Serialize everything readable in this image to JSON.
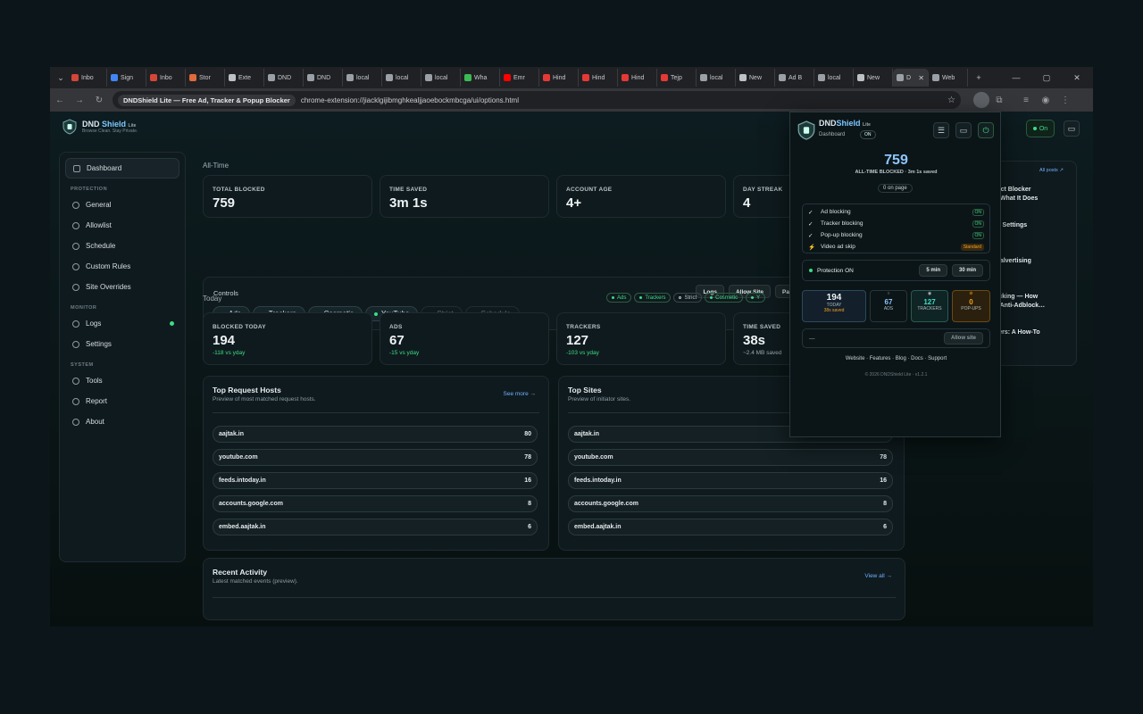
{
  "browser": {
    "tabs": [
      "Inbo",
      "Sign",
      "Inbo",
      "Stor",
      "Exte",
      "DND",
      "DND",
      "local",
      "local",
      "local",
      "Wha",
      "Emr",
      "Hind",
      "Hind",
      "Hind",
      "Tejp",
      "local",
      "New",
      "Ad B",
      "local",
      "New",
      "D",
      "Web"
    ],
    "tab_colors": [
      "#d44638",
      "#4285f4",
      "#d44638",
      "#e06a3a",
      "#bdc1c6",
      "#9aa0a6",
      "#9aa0a6",
      "#9aa0a6",
      "#9aa0a6",
      "#9aa0a6",
      "#3cba54",
      "#ff0000",
      "#e53935",
      "#e53935",
      "#e53935",
      "#e53935",
      "#9aa0a6",
      "#bdc1c6",
      "#9aa0a6",
      "#9aa0a6",
      "#bdc1c6",
      "#9aa0a6",
      "#9aa0a6"
    ],
    "chip_label": "DNDShield Lite — Free Ad, Tracker & Popup Blocker",
    "url": "chrome-extension://jiacklgijibmghkealjjaoebockmbcga/ui/options.html",
    "new_tab": "+",
    "window_controls": [
      "—",
      "▢",
      "✕"
    ]
  },
  "brand": {
    "name_a": "DND ",
    "name_b": "Shield",
    "lite": "Lite",
    "tagline": "Browse Clean. Stay Private."
  },
  "sidebar": {
    "dashboard": "Dashboard",
    "protection_head": "PROTECTION",
    "protection": [
      "General",
      "Allowlist",
      "Schedule",
      "Custom Rules",
      "Site Overrides"
    ],
    "monitor_head": "MONITOR",
    "monitor": [
      "Logs",
      "Settings"
    ],
    "system_head": "SYSTEM",
    "system": [
      "Tools",
      "Report",
      "About"
    ]
  },
  "alltime": {
    "label": "All-Time",
    "stats": [
      {
        "label": "TOTAL BLOCKED",
        "value": "759"
      },
      {
        "label": "TIME SAVED",
        "value": "3m 1s"
      },
      {
        "label": "ACCOUNT AGE",
        "value": "4+"
      },
      {
        "label": "DAY STREAK",
        "value": "4"
      }
    ]
  },
  "controls": {
    "title": "Controls",
    "buttons": [
      "Logs",
      "Allow Site",
      "Pause 10m"
    ],
    "toggles": [
      {
        "label": "Ads",
        "on": true
      },
      {
        "label": "Trackers",
        "on": true
      },
      {
        "label": "Cosmetic",
        "on": true
      },
      {
        "label": "YouTube",
        "on": true
      },
      {
        "label": "Strict",
        "on": false
      },
      {
        "label": "Schedule",
        "on": false
      }
    ]
  },
  "today": {
    "label": "Today",
    "mode_pills": [
      "Ads",
      "Trackers",
      "Strict",
      "Cosmetic",
      "Y"
    ],
    "stats": [
      {
        "label": "BLOCKED TODAY",
        "value": "194",
        "sub": "-118 vs yday"
      },
      {
        "label": "ADS",
        "value": "67",
        "sub": "-15 vs yday"
      },
      {
        "label": "TRACKERS",
        "value": "127",
        "sub": "-103 vs yday"
      },
      {
        "label": "TIME SAVED",
        "value": "38s",
        "sub": "~2.4 MB saved"
      }
    ]
  },
  "top_hosts": {
    "title": "Top Request Hosts",
    "subtitle": "Preview of most matched request hosts.",
    "see_more": "See more →",
    "rows": [
      {
        "host": "aajtak.in",
        "count": "80"
      },
      {
        "host": "youtube.com",
        "count": "78"
      },
      {
        "host": "feeds.intoday.in",
        "count": "16"
      },
      {
        "host": "accounts.google.com",
        "count": "8"
      },
      {
        "host": "embed.aajtak.in",
        "count": "6"
      }
    ]
  },
  "top_sites": {
    "title": "Top Sites",
    "subtitle": "Preview of initiator sites.",
    "rows": [
      {
        "host": "aajtak.in",
        "count": "80"
      },
      {
        "host": "youtube.com",
        "count": "78"
      },
      {
        "host": "feeds.intoday.in",
        "count": "16"
      },
      {
        "host": "accounts.google.com",
        "count": "8"
      },
      {
        "host": "embed.aajtak.in",
        "count": "6"
      }
    ]
  },
  "recent": {
    "title": "Recent Activity",
    "subtitle": "Latest matched events (preview).",
    "view_all": "View all →"
  },
  "header": {
    "on_label": "On"
  },
  "blog": {
    "all_posts": "All posts ↗",
    "items": [
      "rect Blocker\ny What It Does",
      "er Settings",
      "Malvertising",
      "ocking — How\ns Anti-Adblock…",
      "lters: A How-To"
    ]
  },
  "popup": {
    "title_a": "DND",
    "title_b": "Shield",
    "lite": "Lite",
    "subtitle": "Dashboard",
    "on_badge": "ON",
    "big": "759",
    "big_sub": "ALL-TIME BLOCKED · 3m 1s saved",
    "on_page": "0 on page",
    "features": [
      {
        "mark": "✓",
        "label": "Ad blocking",
        "badge": "ON"
      },
      {
        "mark": "✓",
        "label": "Tracker blocking",
        "badge": "ON"
      },
      {
        "mark": "✓",
        "label": "Pop-up blocking",
        "badge": "ON"
      },
      {
        "mark": "⚡",
        "label": "Video ad skip",
        "badge": "Standard"
      }
    ],
    "protection": "Protection ON",
    "btn5": "5 min",
    "btn30": "30 min",
    "today_n": "194",
    "today_l": "TODAY",
    "today_s": "38s saved",
    "ads_n": "67",
    "ads_l": "ADS",
    "trk_n": "127",
    "trk_l": "TRACKERS",
    "pop_n": "0",
    "pop_l": "POP-UPS",
    "site": "—",
    "allow": "Allow site",
    "links": "Website · Features · Blog · Docs · Support",
    "copyright": "© 2026 DNDShield Lite · v1.2.1"
  }
}
